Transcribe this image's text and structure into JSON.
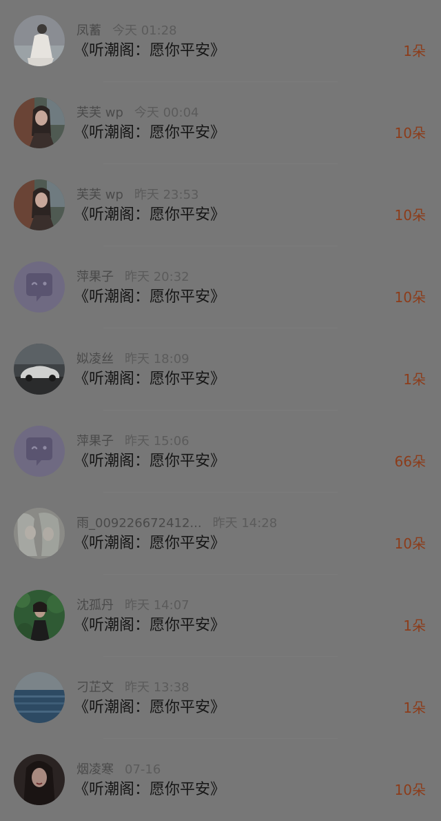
{
  "list": {
    "items": [
      {
        "username": "凤蓄",
        "time": "今天 01:28",
        "title": "《听潮阁：愿你平安》",
        "count": "1朵",
        "avatar": "photo-white-dress"
      },
      {
        "username": "芙芙 wp",
        "time": "今天 00:04",
        "title": "《听潮阁：愿你平安》",
        "count": "10朵",
        "avatar": "photo-car-selfie"
      },
      {
        "username": "芙芙 wp",
        "time": "昨天 23:53",
        "title": "《听潮阁：愿你平安》",
        "count": "10朵",
        "avatar": "photo-car-selfie"
      },
      {
        "username": "萍果子",
        "time": "昨天 20:32",
        "title": "《听潮阁：愿你平安》",
        "count": "10朵",
        "avatar": "default-chat-bubble"
      },
      {
        "username": "姒凌丝",
        "time": "昨天 18:09",
        "title": "《听潮阁：愿你平安》",
        "count": "1朵",
        "avatar": "photo-sports-car"
      },
      {
        "username": "萍果子",
        "time": "昨天 15:06",
        "title": "《听潮阁：愿你平安》",
        "count": "66朵",
        "avatar": "default-chat-bubble"
      },
      {
        "username": "雨_009226672412...",
        "time": "昨天 14:28",
        "title": "《听潮阁：愿你平安》",
        "count": "10朵",
        "avatar": "illustration-white-hair"
      },
      {
        "username": "沈孤丹",
        "time": "昨天 14:07",
        "title": "《听潮阁：愿你平安》",
        "count": "1朵",
        "avatar": "photo-green-leaves"
      },
      {
        "username": "刁芷文",
        "time": "昨天 13:38",
        "title": "《听潮阁：愿你平安》",
        "count": "1朵",
        "avatar": "photo-sea"
      },
      {
        "username": "烟凌寒",
        "time": "07-16",
        "title": "《听潮阁：愿你平安》",
        "count": "10朵",
        "avatar": "photo-dark-portrait"
      }
    ]
  }
}
